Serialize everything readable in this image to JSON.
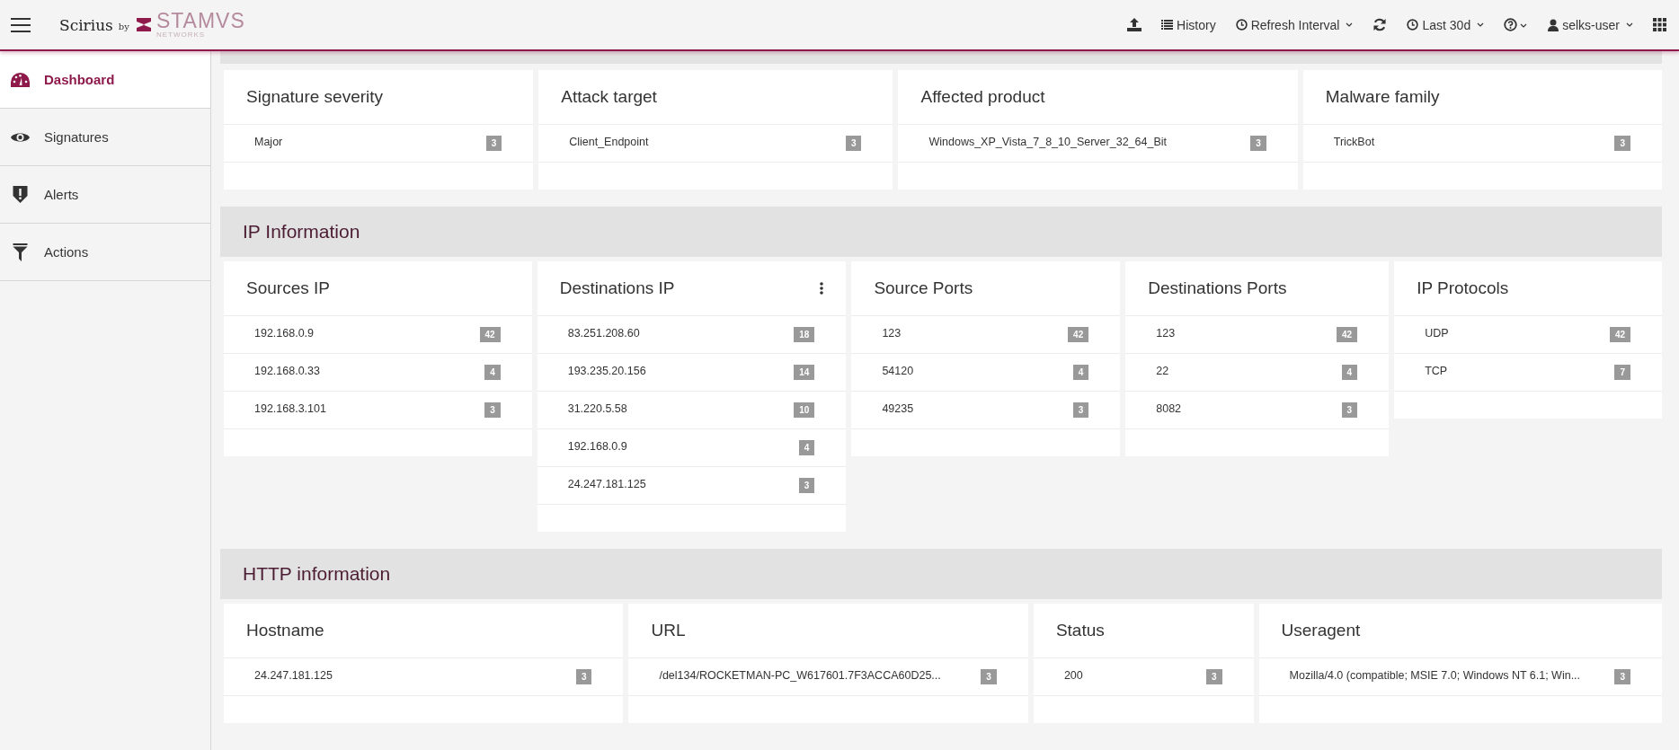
{
  "header": {
    "brand": "Scirius",
    "by": "by",
    "logo_text": "STAMVS",
    "logo_sub": "NETWORKS",
    "history": "History",
    "refresh_interval": "Refresh Interval",
    "time_range": "Last 30d",
    "user": "selks-user"
  },
  "sidebar": {
    "items": [
      {
        "label": "Dashboard",
        "kind": "dashboard",
        "selected": true
      },
      {
        "label": "Signatures",
        "kind": "signatures",
        "selected": false
      },
      {
        "label": "Alerts",
        "kind": "alerts",
        "selected": false
      },
      {
        "label": "Actions",
        "kind": "actions",
        "selected": false
      }
    ]
  },
  "sections": [
    {
      "cards": [
        {
          "title": "Signature severity",
          "has_menu": false,
          "items": [
            {
              "label": "Major",
              "count": "3"
            }
          ]
        },
        {
          "title": "Attack target",
          "has_menu": false,
          "items": [
            {
              "label": "Client_Endpoint",
              "count": "3"
            }
          ]
        },
        {
          "title": "Affected product",
          "has_menu": false,
          "items": [
            {
              "label": "Windows_XP_Vista_7_8_10_Server_32_64_Bit",
              "count": "3"
            }
          ]
        },
        {
          "title": "Malware family",
          "has_menu": false,
          "items": [
            {
              "label": "TrickBot",
              "count": "3"
            }
          ]
        }
      ]
    },
    {
      "title": "IP Information",
      "cards": [
        {
          "title": "Sources IP",
          "has_menu": false,
          "items": [
            {
              "label": "192.168.0.9",
              "count": "42"
            },
            {
              "label": "192.168.0.33",
              "count": "4"
            },
            {
              "label": "192.168.3.101",
              "count": "3"
            }
          ]
        },
        {
          "title": "Destinations IP",
          "has_menu": true,
          "items": [
            {
              "label": "83.251.208.60",
              "count": "18"
            },
            {
              "label": "193.235.20.156",
              "count": "14"
            },
            {
              "label": "31.220.5.58",
              "count": "10"
            },
            {
              "label": "192.168.0.9",
              "count": "4"
            },
            {
              "label": "24.247.181.125",
              "count": "3"
            }
          ]
        },
        {
          "title": "Source Ports",
          "has_menu": false,
          "items": [
            {
              "label": "123",
              "count": "42"
            },
            {
              "label": "54120",
              "count": "4"
            },
            {
              "label": "49235",
              "count": "3"
            }
          ]
        },
        {
          "title": "Destinations Ports",
          "has_menu": false,
          "items": [
            {
              "label": "123",
              "count": "42"
            },
            {
              "label": "22",
              "count": "4"
            },
            {
              "label": "8082",
              "count": "3"
            }
          ]
        },
        {
          "title": "IP Protocols",
          "has_menu": false,
          "items": [
            {
              "label": "UDP",
              "count": "42"
            },
            {
              "label": "TCP",
              "count": "7"
            }
          ]
        }
      ]
    },
    {
      "title": "HTTP information",
      "cards": [
        {
          "title": "Hostname",
          "has_menu": false,
          "items": [
            {
              "label": "24.247.181.125",
              "count": "3"
            }
          ]
        },
        {
          "title": "URL",
          "has_menu": false,
          "items": [
            {
              "label": "/del134/ROCKETMAN-PC_W617601.7F3ACCA60D25...",
              "count": "3"
            }
          ]
        },
        {
          "title": "Status",
          "has_menu": false,
          "items": [
            {
              "label": "200",
              "count": "3"
            }
          ]
        },
        {
          "title": "Useragent",
          "has_menu": false,
          "items": [
            {
              "label": "Mozilla/4.0 (compatible; MSIE 7.0; Windows NT 6.1; Win...",
              "count": "3"
            }
          ]
        }
      ]
    }
  ]
}
